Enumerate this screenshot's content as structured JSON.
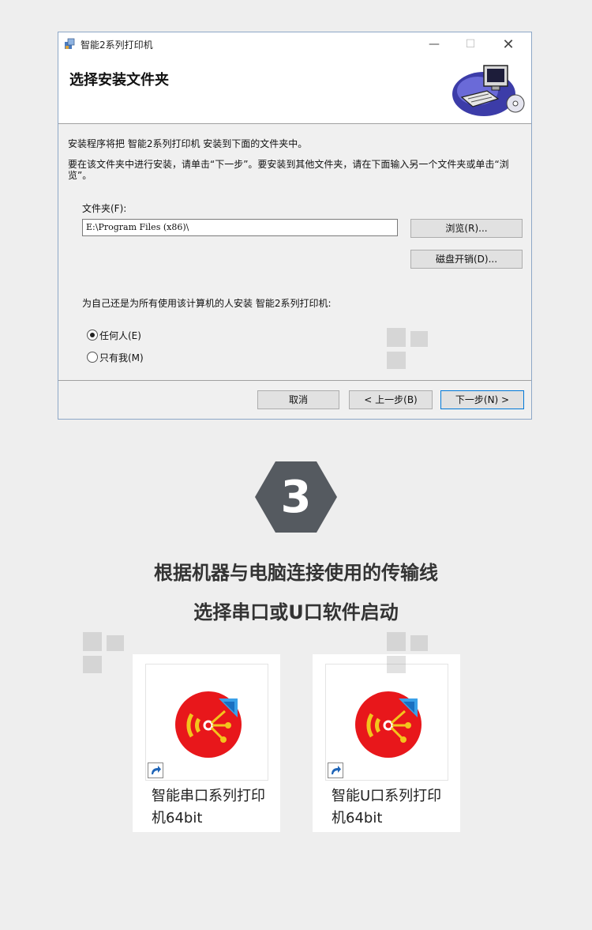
{
  "installer": {
    "window_title": "智能2系列打印机",
    "minimize_glyph": "—",
    "maximize_glyph": "☐",
    "close_glyph": "✕",
    "header_title": "选择安装文件夹",
    "intro_line1": "安装程序将把 智能2系列打印机 安装到下面的文件夹中。",
    "intro_line2": "要在该文件夹中进行安装，请单击“下一步”。要安装到其他文件夹，请在下面输入另一个文件夹或单击“浏览”。",
    "folder_label": "文件夹(F):",
    "folder_value": "E:\\Program Files (x86)\\",
    "browse_label": "浏览(R)...",
    "disk_cost_label": "磁盘开销(D)...",
    "install_for_question": "为自己还是为所有使用该计算机的人安装 智能2系列打印机:",
    "radio_everyone": "任何人(E)",
    "radio_just_me": "只有我(M)",
    "selected_option": "everyone",
    "cancel_label": "取消",
    "back_label": "< 上一步(B)",
    "next_label": "下一步(N) >"
  },
  "step": {
    "number": "3",
    "badge_color": "#555a60"
  },
  "captions": {
    "line1": "根据机器与电脑连接使用的传输线",
    "line2": "选择串口或U口软件启动"
  },
  "shortcuts": [
    {
      "label": "智能串口系列打印机64bit",
      "icon": "printer-disc-icon"
    },
    {
      "label": "智能U口系列打印机64bit",
      "icon": "printer-disc-icon"
    }
  ],
  "colors": {
    "disc_red": "#e8171b",
    "disc_yellow": "#f3c51c",
    "accent_blue": "#0078d7"
  }
}
